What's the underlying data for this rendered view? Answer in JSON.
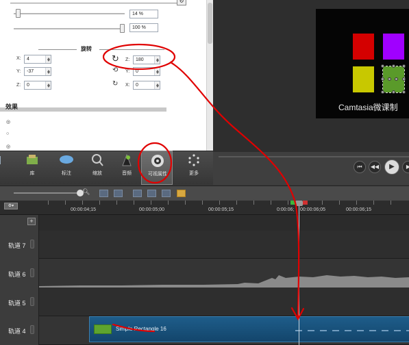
{
  "properties": {
    "opacity_value": "14 %",
    "scale_value": "100 %",
    "rotation_heading": "旋转",
    "position": [
      {
        "axis": "X:",
        "value": "4"
      },
      {
        "axis": "Y:",
        "value": "-37"
      },
      {
        "axis": "Z:",
        "value": "0"
      }
    ],
    "rotation": [
      {
        "axis": "Z:",
        "value": "180"
      },
      {
        "axis": "Y:",
        "value": "0"
      },
      {
        "axis": "X:",
        "value": "0"
      }
    ],
    "effects_heading": "效果",
    "effect_radios": [
      "◎",
      "○",
      "◎"
    ]
  },
  "preview": {
    "caption": "Camtasia微课制",
    "swatch_colors": {
      "red": "#d40000",
      "purple": "#a000ff",
      "yellow": "#c8c800",
      "green": "#5a9a2a"
    }
  },
  "toolbar": {
    "library_label": "库",
    "callouts_label": "标注",
    "zoom_label": "缩放",
    "audio_label": "音频",
    "visual_props_label": "可视属性",
    "more_label": "更多"
  },
  "timeline": {
    "timecodes": [
      "00:00:04;15",
      "00:00:05;00",
      "00:00:05;15",
      "0:00:06;",
      "00:00:06;05",
      "00:00:06;15"
    ],
    "tracks": [
      {
        "name": "轨道 7"
      },
      {
        "name": "轨道 6"
      },
      {
        "name": "轨道 5"
      },
      {
        "name": "轨道 4"
      }
    ],
    "clip_name": "Simple Rectangle 16",
    "add_track": "+"
  },
  "annotation_color": "#e00000"
}
